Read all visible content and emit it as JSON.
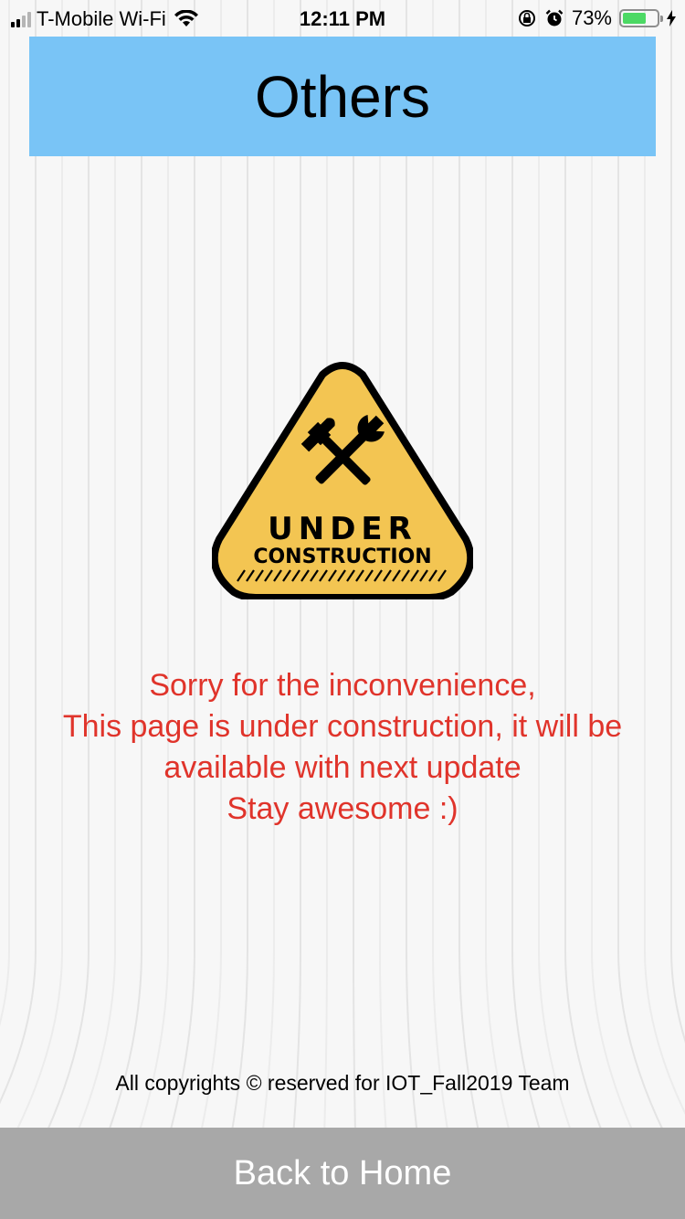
{
  "status_bar": {
    "carrier": "T-Mobile Wi-Fi",
    "time": "12:11 PM",
    "battery_percent": "73%",
    "battery_level": 0.73,
    "icons": [
      "signal-icon",
      "wifi-icon",
      "rotation-lock-icon",
      "alarm-icon",
      "battery-icon",
      "charging-bolt-icon"
    ]
  },
  "header": {
    "title": "Others"
  },
  "sign": {
    "line1": "UNDER",
    "line2": "CONSTRUCTION",
    "icon": "hammer-wrench-icon"
  },
  "message": {
    "lines": [
      "Sorry for the inconvenience,",
      "This page is under construction, it will be available with next update",
      "Stay awesome :)"
    ],
    "color": "#e0342b"
  },
  "footer": {
    "copyright": "All copyrights © reserved for IOT_Fall2019 Team"
  },
  "back_button": {
    "label": "Back to Home"
  },
  "colors": {
    "header_bg": "#79c4f6",
    "button_bg": "#a8a8a8",
    "sign_yellow": "#f3c552"
  }
}
